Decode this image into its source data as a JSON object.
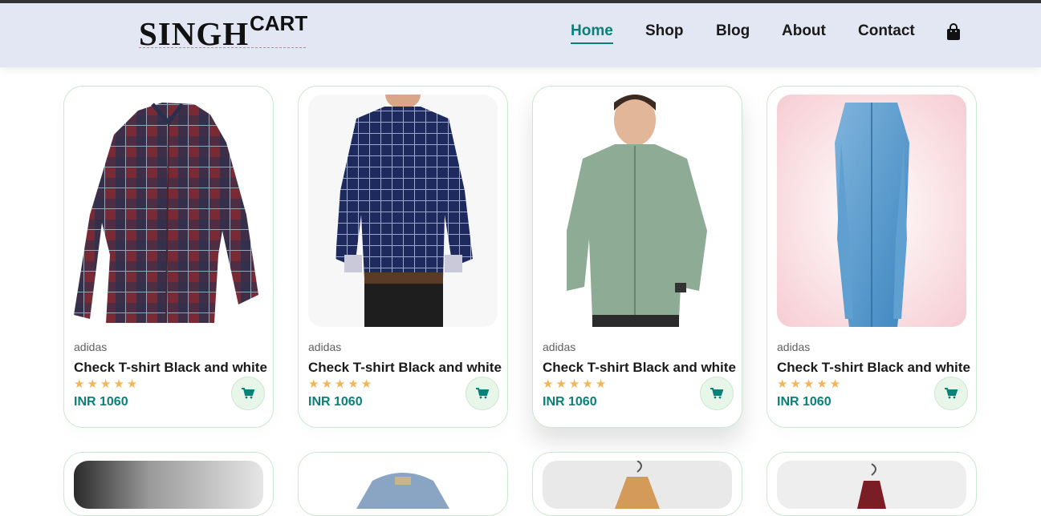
{
  "header": {
    "logo_main": "SINGH",
    "logo_sup": "CART",
    "nav": [
      {
        "label": "Home",
        "active": true
      },
      {
        "label": "Shop",
        "active": false
      },
      {
        "label": "Blog",
        "active": false
      },
      {
        "label": "About",
        "active": false
      },
      {
        "label": "Contact",
        "active": false
      }
    ],
    "bag_icon": "shopping-bag-icon"
  },
  "products": [
    {
      "brand": "adidas",
      "title": "Check T-shirt Black and white",
      "stars": "★★★★★",
      "rating": 5,
      "price": "INR 1060",
      "image": "red-navy-plaid-shirt"
    },
    {
      "brand": "adidas",
      "title": "Check T-shirt Black and white",
      "stars": "★★★★★",
      "rating": 5,
      "price": "INR 1060",
      "image": "navy-check-shirt-model"
    },
    {
      "brand": "adidas",
      "title": "Check T-shirt Black and white",
      "stars": "★★★★★",
      "rating": 5,
      "price": "INR 1060",
      "image": "green-check-shirt-model"
    },
    {
      "brand": "adidas",
      "title": "Check T-shirt Black and white",
      "stars": "★★★★★",
      "rating": 5,
      "price": "INR 1060",
      "image": "denim-shirt-model"
    }
  ],
  "colors": {
    "accent": "#088178",
    "header_bg": "#e3e6f3",
    "star": "#f3b55b",
    "card_border": "#cce7d0",
    "cart_bg": "#e8f6ea"
  }
}
